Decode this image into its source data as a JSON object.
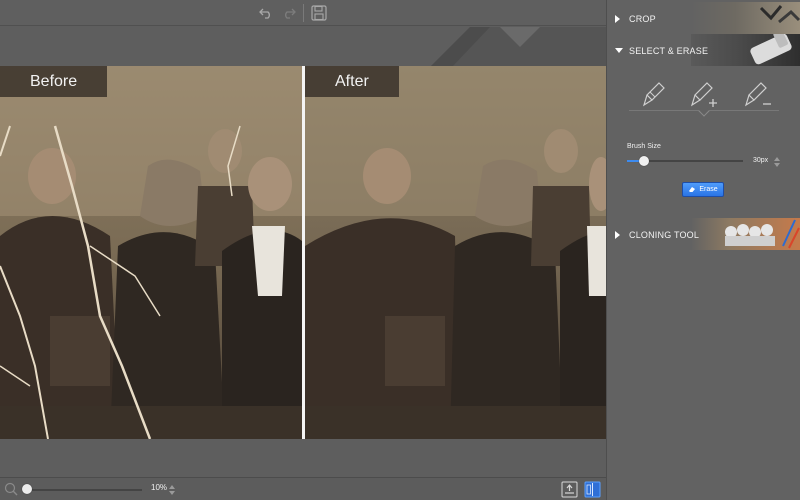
{
  "toolbar": {
    "undo_icon": "undo-icon",
    "redo_icon": "redo-icon",
    "save_icon": "save-icon"
  },
  "photos": {
    "before_label": "Before",
    "after_label": "After"
  },
  "bottom_bar": {
    "zoom_value": "10%",
    "zoom_icon": "magnifier-icon",
    "export_icon": "export-icon",
    "split_view_icon": "split-view-icon"
  },
  "panel": {
    "sections": {
      "crop": "CROP",
      "select_erase": "SELECT & ERASE",
      "cloning": "CLONING TOOL"
    },
    "tools": [
      "brush-icon",
      "brush-add-icon",
      "brush-subtract-icon"
    ],
    "brush": {
      "label": "Brush Size",
      "value": "30px"
    },
    "erase_button": "Erase"
  },
  "colors": {
    "accent": "#3d8bf0",
    "panel_bg": "#626262",
    "toolbar_bg": "#5f5f5f"
  }
}
